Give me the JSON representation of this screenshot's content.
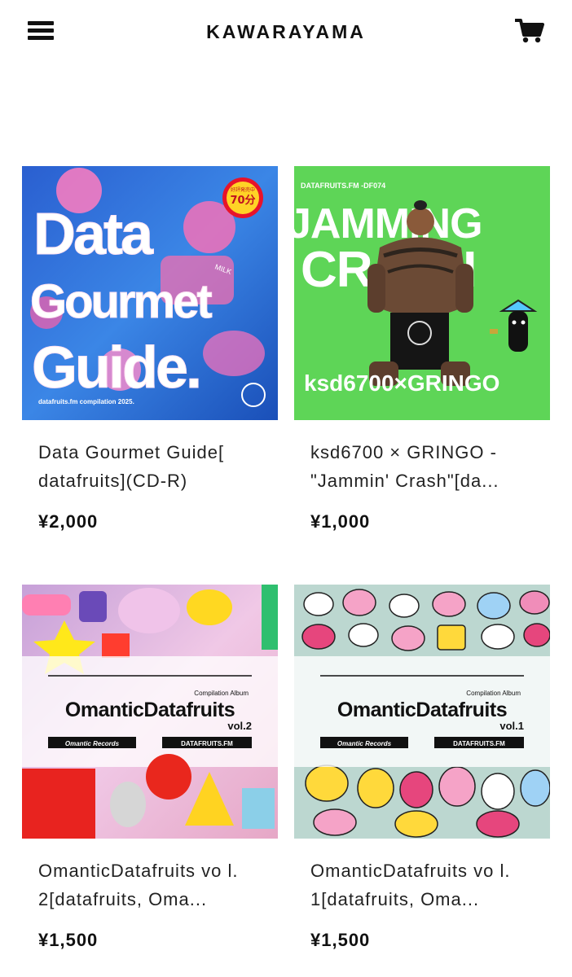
{
  "header": {
    "brand": "KAWARAYAMA",
    "menu_icon": "hamburger-menu-icon",
    "cart_icon": "shopping-cart-icon"
  },
  "products": [
    {
      "title": "Data Gourmet Guide[ datafruits](CD-R)",
      "price": "¥2,000",
      "cover": {
        "words": [
          "Data",
          "Gourmet",
          "Guide."
        ],
        "badge_top": "好評発売中",
        "badge_main": "70分",
        "tag": "MILK",
        "footer": "datafruits.fm compilation 2025."
      }
    },
    {
      "title": "ksd6700 × GRINGO - \"Jammin' Crash\"[da...",
      "price": "¥1,000",
      "cover": {
        "top": "DATAFRUITS.FM -DF074",
        "word1": "JAMMING",
        "word2": "CRASH",
        "bottom": "ksd6700×GRINGO"
      }
    },
    {
      "title": "OmanticDatafruits vo l. 2[datafruits, Oma...",
      "price": "¥1,500",
      "cover": {
        "small": "Compilation Album",
        "name": "OmanticDatafruits",
        "vol": "vol.2",
        "label_left": "Omantic Records",
        "label_right": "DATAFRUITS.FM"
      }
    },
    {
      "title": "OmanticDatafruits vo l. 1[datafruits, Oma...",
      "price": "¥1,500",
      "cover": {
        "small": "Compilation Album",
        "name": "OmanticDatafruits",
        "vol": "vol.1",
        "label_left": "Omantic Records",
        "label_right": "DATAFRUITS.FM"
      }
    }
  ],
  "colors": {
    "cover1_bg": "#1d6fd8",
    "cover1_accent": "#ff5fa8",
    "cover2_bg": "#4fd14a",
    "cover3_bg": "#e8b9e8",
    "cover4_bg": "#b9d6d0"
  }
}
